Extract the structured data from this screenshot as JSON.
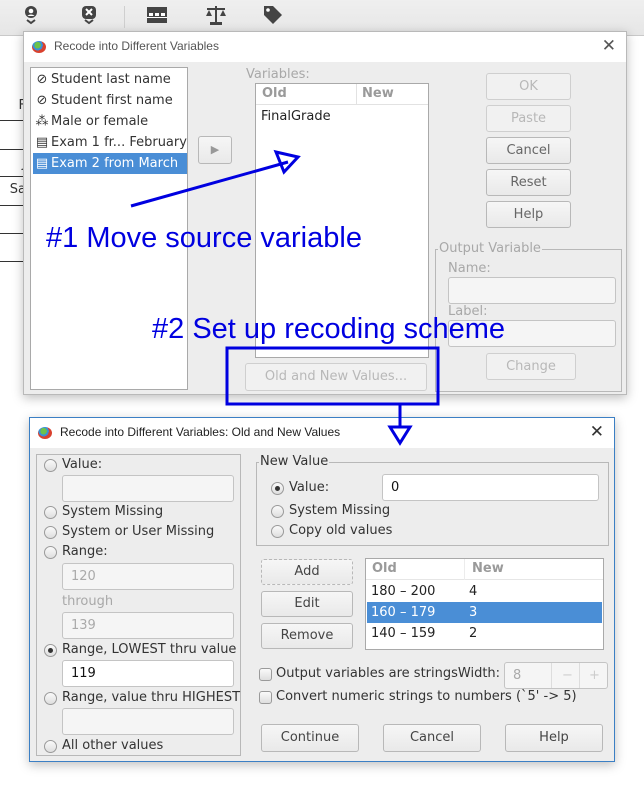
{
  "toolbar": {
    "icons": [
      "go-to-case-icon",
      "delete-case-icon",
      "split-file-icon",
      "weight-cases-icon",
      "value-labels-icon"
    ]
  },
  "background_sheet": {
    "cells": [
      "F",
      "J",
      "Sa"
    ]
  },
  "dialog_main": {
    "title": "Recode into Different Variables",
    "source_variables": [
      {
        "label": "Student last name",
        "icon": "string-variable-icon",
        "selected": false
      },
      {
        "label": "Student first name",
        "icon": "string-variable-icon",
        "selected": false
      },
      {
        "label": "Male or female",
        "icon": "nominal-variable-icon",
        "selected": false
      },
      {
        "label": "Exam 1 fr... February",
        "icon": "scale-variable-icon",
        "selected": false
      },
      {
        "label": "Exam 2 from March",
        "icon": "scale-variable-icon",
        "selected": true
      }
    ],
    "variables_label": "Variables:",
    "variables_table": {
      "headers": [
        "Old",
        "New"
      ],
      "rows": [
        [
          "FinalGrade",
          ""
        ]
      ]
    },
    "old_new_button": "Old and New Values...",
    "buttons": {
      "ok": "OK",
      "paste": "Paste",
      "cancel": "Cancel",
      "reset": "Reset",
      "help": "Help"
    },
    "output_variable": {
      "group_label": "Output Variable",
      "name_label": "Name:",
      "name_value": "",
      "label_label": "Label:",
      "label_value": "",
      "change_button": "Change"
    }
  },
  "dialog_values": {
    "title": "Recode into Different Variables: Old and New Values",
    "old_value": {
      "value_label": "Value:",
      "value_input": "",
      "system_missing": "System Missing",
      "system_or_user_missing": "System or User Missing",
      "range_label": "Range:",
      "range_from": "120",
      "through_label": "through",
      "range_to": "139",
      "range_lowest_label": "Range, LOWEST thru value",
      "range_lowest_value": "119",
      "range_highest_label": "Range, value thru HIGHEST",
      "range_highest_value": "",
      "all_other": "All other values",
      "selected": "range_lowest"
    },
    "new_value": {
      "group_label": "New Value",
      "value_label": "Value:",
      "value_input": "0",
      "system_missing": "System Missing",
      "copy_old": "Copy old values",
      "selected": "value"
    },
    "actions": {
      "add": "Add",
      "edit": "Edit",
      "remove": "Remove"
    },
    "mapping_table": {
      "headers": [
        "Old",
        "New"
      ],
      "rows": [
        {
          "old": "180 – 200",
          "new": "4",
          "selected": false
        },
        {
          "old": "160 – 179",
          "new": "3",
          "selected": true
        },
        {
          "old": "140 – 159",
          "new": "2",
          "selected": false
        }
      ]
    },
    "output_strings_label": "Output variables are strings",
    "width_label": "Width:",
    "width_value": "8",
    "convert_label": "Convert numeric strings to numbers (`5' -> 5)",
    "buttons": {
      "continue": "Continue",
      "cancel": "Cancel",
      "help": "Help"
    }
  },
  "annotations": {
    "step1": "#1 Move source variable",
    "step2": "#2 Set up recoding scheme",
    "color": "#0000e0"
  }
}
